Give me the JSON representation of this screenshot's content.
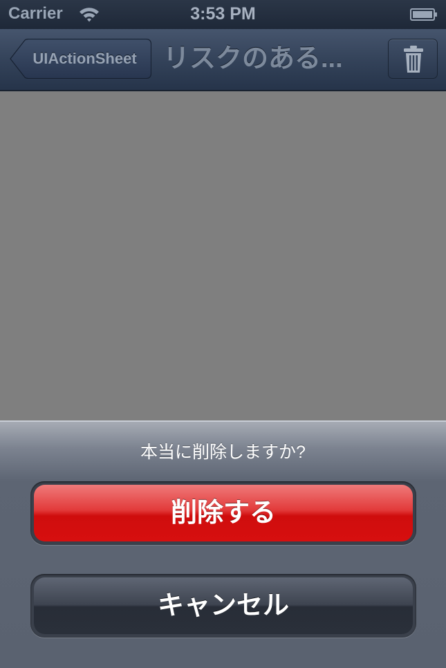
{
  "status_bar": {
    "carrier": "Carrier",
    "time": "3:53 PM",
    "wifi_icon": "wifi-icon",
    "battery_icon": "battery-icon"
  },
  "nav_bar": {
    "back_label": "UIActionSheet",
    "title": "リスクのある...",
    "right_icon": "trash-icon"
  },
  "action_sheet": {
    "title": "本当に削除しますか?",
    "destructive_label": "削除する",
    "cancel_label": "キャンセル"
  },
  "colors": {
    "destructive": "#d70f0f",
    "nav_bar": "#34435a",
    "content_background": "#7f7f7f"
  }
}
